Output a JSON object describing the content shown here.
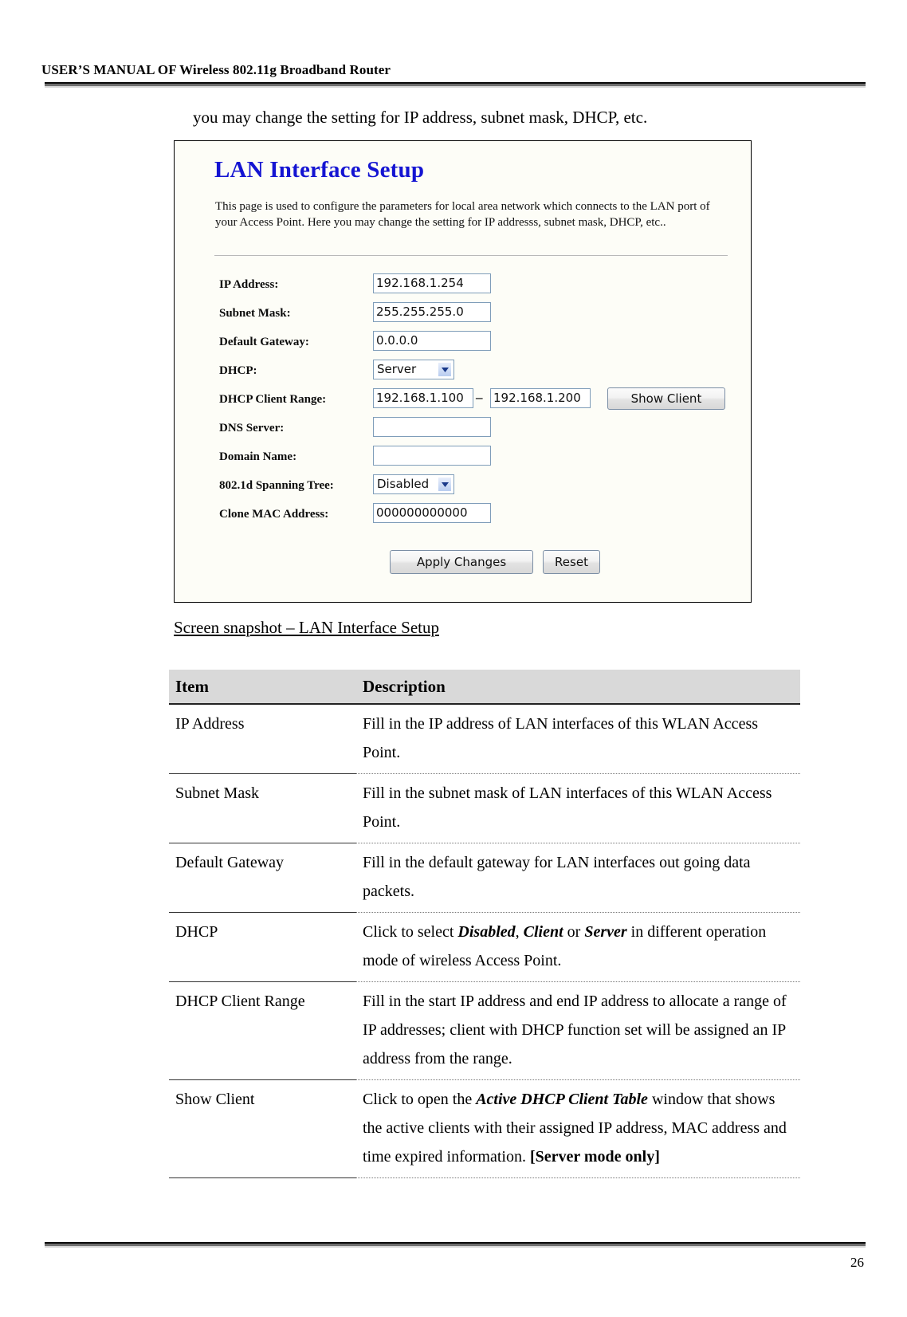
{
  "header": {
    "running_title": "USER’S MANUAL OF Wireless 802.11g Broadband Router"
  },
  "footer": {
    "page_number": "26"
  },
  "intro": {
    "text": "you may change the setting for IP address, subnet mask, DHCP, etc."
  },
  "snapshot": {
    "title": "LAN Interface Setup",
    "description": "This page is used to configure the parameters for local area network which connects to the LAN port of your Access Point. Here you may change the setting for IP addresss, subnet mask, DHCP, etc..",
    "fields": {
      "ip_address": {
        "label": "IP Address:",
        "value": "192.168.1.254"
      },
      "subnet_mask": {
        "label": "Subnet Mask:",
        "value": "255.255.255.0"
      },
      "default_gateway": {
        "label": "Default Gateway:",
        "value": "0.0.0.0"
      },
      "dhcp": {
        "label": "DHCP:",
        "value": "Server"
      },
      "dhcp_client_range": {
        "label": "DHCP Client Range:",
        "start": "192.168.1.100",
        "separator": "–",
        "end": "192.168.1.200",
        "button": "Show Client"
      },
      "dns_server": {
        "label": "DNS Server:",
        "value": ""
      },
      "domain_name": {
        "label": "Domain Name:",
        "value": ""
      },
      "spanning_tree": {
        "label": "802.1d Spanning Tree:",
        "value": "Disabled"
      },
      "clone_mac": {
        "label": "Clone MAC Address:",
        "value": "000000000000"
      }
    },
    "buttons": {
      "apply": "Apply Changes",
      "reset": "Reset"
    },
    "colors": {
      "title": "#1414d2",
      "input_border": "#7f9db9",
      "select_arrow": "#b9cdf0"
    }
  },
  "caption": {
    "text": "Screen snapshot – LAN Interface Setup"
  },
  "table": {
    "columns": [
      "Item",
      "Description"
    ],
    "rows": [
      {
        "item": "IP Address",
        "description_parts": [
          {
            "text": "Fill in the IP address of LAN interfaces of this WLAN Access Point.",
            "style": "normal"
          }
        ]
      },
      {
        "item": "Subnet Mask",
        "description_parts": [
          {
            "text": "Fill in the subnet mask of LAN interfaces of this WLAN Access Point.",
            "style": "normal"
          }
        ]
      },
      {
        "item": "Default Gateway",
        "description_parts": [
          {
            "text": "Fill in the default gateway for LAN interfaces out going data packets.",
            "style": "normal"
          }
        ]
      },
      {
        "item": "DHCP",
        "description_parts": [
          {
            "text": "Click to select ",
            "style": "normal"
          },
          {
            "text": "Disabled",
            "style": "bold-italic"
          },
          {
            "text": ", ",
            "style": "normal"
          },
          {
            "text": "Client",
            "style": "bold-italic"
          },
          {
            "text": " or ",
            "style": "normal"
          },
          {
            "text": "Server",
            "style": "bold-italic"
          },
          {
            "text": " in different operation mode of wireless Access Point.",
            "style": "normal"
          }
        ]
      },
      {
        "item": "DHCP Client Range",
        "description_parts": [
          {
            "text": "Fill in the start IP address and end IP address to allocate a range of IP addresses; client with DHCP function set will be assigned an IP address from the range.",
            "style": "normal"
          }
        ]
      },
      {
        "item": "Show Client",
        "description_parts": [
          {
            "text": "Click to open the ",
            "style": "normal"
          },
          {
            "text": "Active DHCP Client Table",
            "style": "bold-italic"
          },
          {
            "text": " window that shows the active clients with their assigned IP address, MAC address and time expired information. ",
            "style": "normal"
          },
          {
            "text": "[Server mode only]",
            "style": "bold"
          }
        ]
      }
    ]
  }
}
